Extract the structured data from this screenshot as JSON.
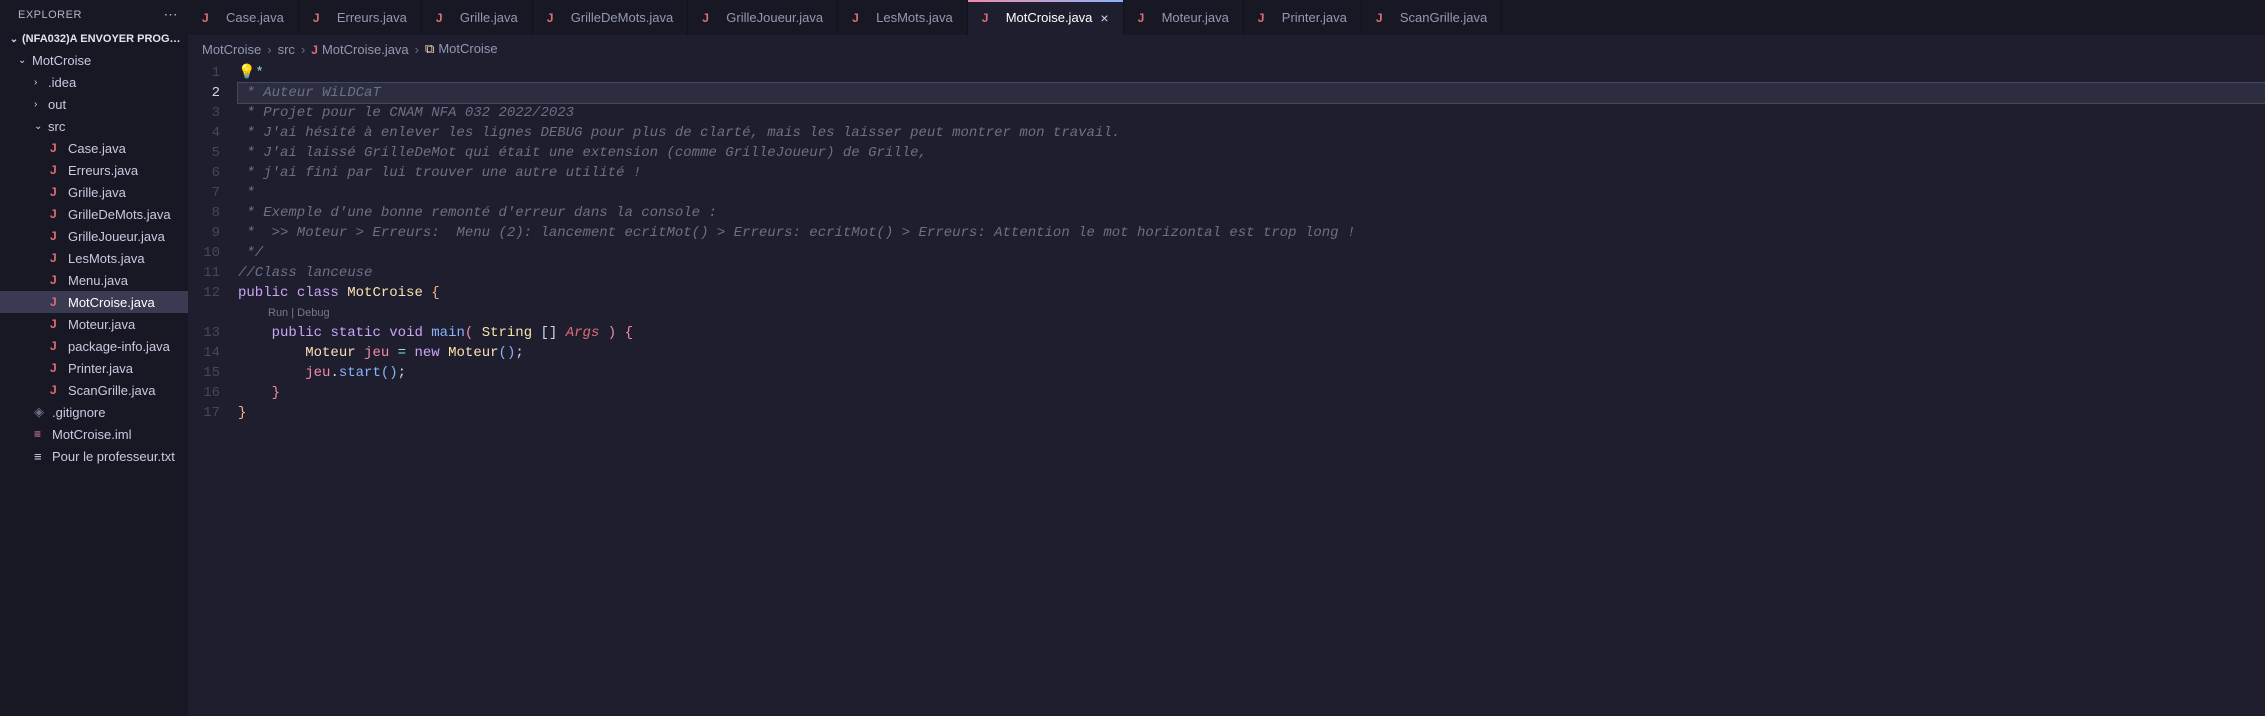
{
  "sidebar": {
    "title": "EXPLORER",
    "project": "(NFA032)A ENVOYER PROG…",
    "tree": {
      "root": "MotCroise",
      "folders": {
        "idea": ".idea",
        "out": "out",
        "src": "src"
      },
      "srcFiles": [
        "Case.java",
        "Erreurs.java",
        "Grille.java",
        "GrilleDeMots.java",
        "GrilleJoueur.java",
        "LesMots.java",
        "Menu.java",
        "MotCroise.java",
        "Moteur.java",
        "package-info.java",
        "Printer.java",
        "ScanGrille.java"
      ],
      "rootFiles": {
        "gitignore": ".gitignore",
        "iml": "MotCroise.iml",
        "prof": "Pour le professeur.txt"
      }
    }
  },
  "tabs": [
    "Case.java",
    "Erreurs.java",
    "Grille.java",
    "GrilleDeMots.java",
    "GrilleJoueur.java",
    "LesMots.java",
    "MotCroise.java",
    "Moteur.java",
    "Printer.java",
    "ScanGrille.java"
  ],
  "activeTab": "MotCroise.java",
  "breadcrumb": {
    "p0": "MotCroise",
    "p1": "src",
    "p2": "MotCroise.java",
    "p3": "MotCroise"
  },
  "codelens": "Run | Debug",
  "lines": {
    "max": 17,
    "current": 2
  },
  "code": {
    "l1_deco": "💡*",
    "l2": " * Auteur WiLDCaT",
    "l3": " * Projet pour le CNAM NFA 032 2022/2023",
    "l4": " * J'ai hésité à enlever les lignes DEBUG pour plus de clarté, mais les laisser peut montrer mon travail.",
    "l5": " * J'ai laissé GrilleDeMot qui était une extension (comme GrilleJoueur) de Grille,",
    "l6": " * j'ai fini par lui trouver une autre utilité !",
    "l7": " *",
    "l8": " * Exemple d'une bonne remonté d'erreur dans la console :",
    "l9": " *  >> Moteur > Erreurs:  Menu (2): lancement ecritMot() > Erreurs: ecritMot() > Erreurs: Attention le mot horizontal est trop long !",
    "l10": " */",
    "l11": "//Class lanceuse",
    "l12": {
      "kw_public": "public",
      "kw_class": "class",
      "name": "MotCroise",
      "brace": "{"
    },
    "l13": {
      "kw_public": "public",
      "kw_static": "static",
      "kw_void": "void",
      "method": "main",
      "lp": "(",
      "type": "String",
      "arr": "[]",
      "param": "Args",
      "rp": ")",
      "brace": "{"
    },
    "l14": {
      "type": "Moteur",
      "var": "jeu",
      "eq": "=",
      "kw_new": "new",
      "ctor": "Moteur",
      "lp": "(",
      "rp": ")",
      "semi": ";"
    },
    "l15": {
      "var": "jeu",
      "dot": ".",
      "method": "start",
      "lp": "(",
      "rp": ")",
      "semi": ";"
    },
    "l16": "    }",
    "l17": "}"
  }
}
